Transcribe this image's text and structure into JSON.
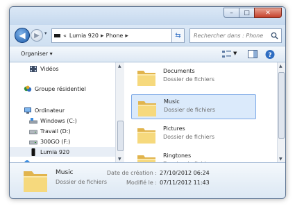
{
  "window": {
    "caption": {
      "minimize": "–",
      "maximize": "□",
      "close": "✕"
    }
  },
  "address_bar": {
    "prefix": "«",
    "crumbs": [
      "Lumia 920",
      "Phone"
    ],
    "separator": "▸",
    "refresh_icon": "refresh-icon"
  },
  "search": {
    "placeholder": "Rechercher dans : Phone"
  },
  "toolbar": {
    "organise_label": "Organiser ▾"
  },
  "nav_pane": {
    "items": [
      {
        "label": "Vidéos",
        "icon": "videos-library-icon"
      },
      {
        "label": "Groupe résidentiel",
        "icon": "homegroup-icon"
      },
      {
        "label": "Ordinateur",
        "icon": "computer-icon"
      },
      {
        "label": "Windows (C:)",
        "icon": "hard-drive-icon"
      },
      {
        "label": "Travail (D:)",
        "icon": "hard-drive-icon"
      },
      {
        "label": "300GO (F:)",
        "icon": "removable-drive-icon"
      },
      {
        "label": "Lumia 920",
        "icon": "phone-icon"
      }
    ]
  },
  "files": {
    "items": [
      {
        "name": "Documents",
        "type": "Dossier de fichiers"
      },
      {
        "name": "Music",
        "type": "Dossier de fichiers"
      },
      {
        "name": "Pictures",
        "type": "Dossier de fichiers"
      },
      {
        "name": "Ringtones",
        "type": "Dossier de fichiers"
      }
    ]
  },
  "details": {
    "name": "Music",
    "type": "Dossier de fichiers",
    "created_label": "Date de création :",
    "created_value": "27/10/2012 06:24",
    "modified_label": "Modifié le :",
    "modified_value": "07/11/2012 11:43"
  },
  "colors": {
    "accent": "#2b6ac2",
    "selection": "#dbeafb",
    "folder": "#f2cf6e"
  }
}
